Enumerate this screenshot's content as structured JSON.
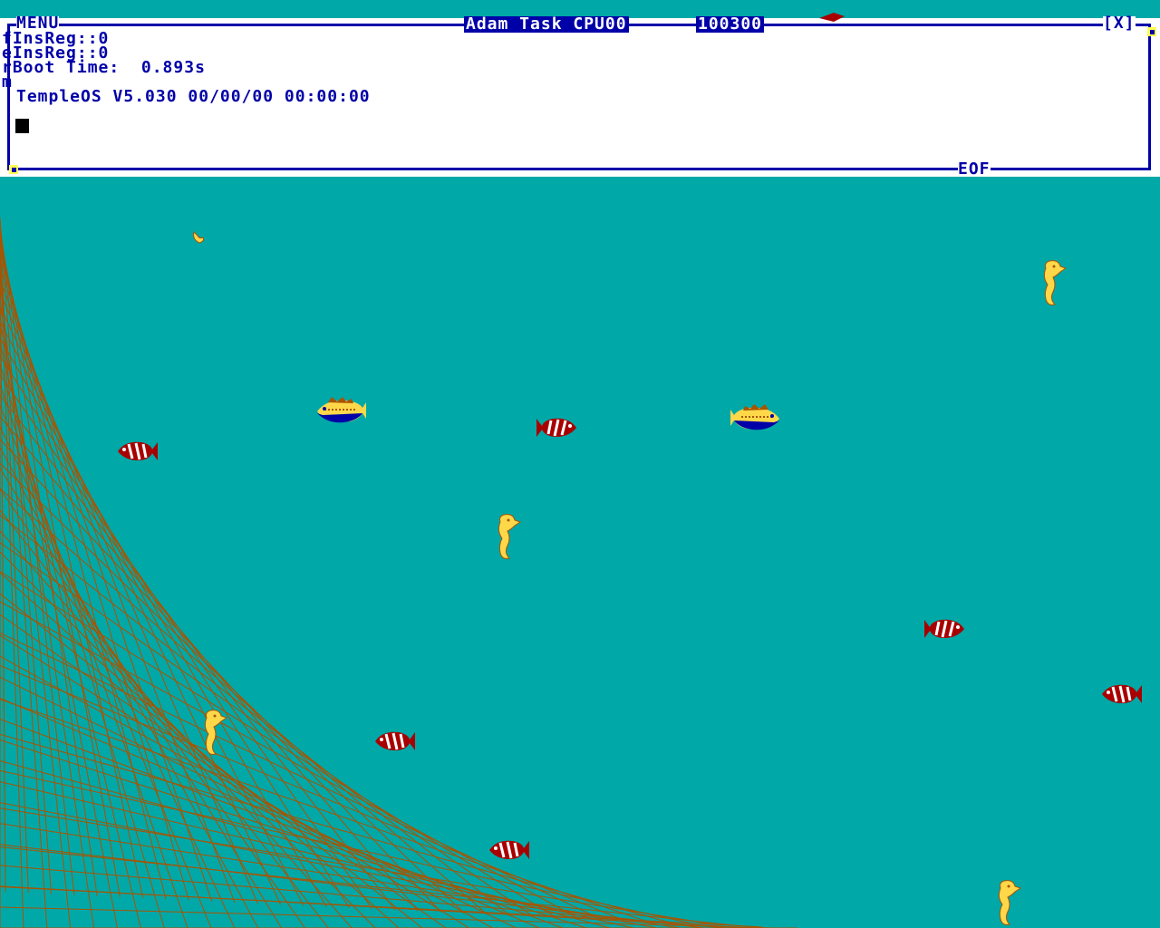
{
  "window": {
    "menu_label": "MENU",
    "title": "Adam Task CPU00",
    "clock": "100300",
    "close_label": "[X]",
    "eof_label": "EOF"
  },
  "console": {
    "lines": [
      "fInsReg::0",
      "eInsReg::0",
      "rBoot Time:  0.893s",
      "m"
    ],
    "version_line": "TempleOS V5.030 00/00/00 00:00:00"
  },
  "colors": {
    "background": "#00A8A8",
    "window": "#ffffff",
    "border": "#0000A8",
    "net": "#A85400",
    "seahorse": "#FFD84A",
    "clownfish": "#A80000"
  },
  "aquarium": {
    "seahorses": 4,
    "red_fish": 7,
    "blue_fish": 2
  }
}
